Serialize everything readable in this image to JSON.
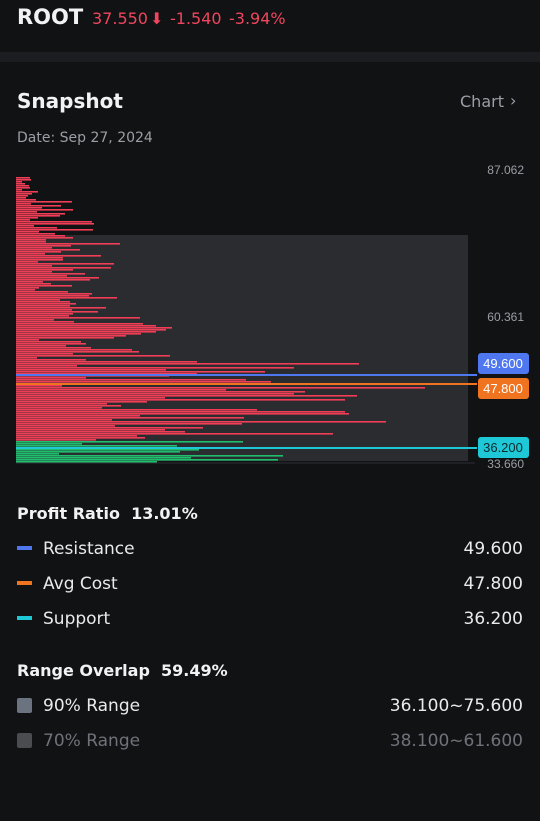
{
  "header": {
    "ticker": "ROOT",
    "price": "37.550",
    "arrow_icon": "arrow-down-icon",
    "arrow_glyph": "⬇",
    "change": "-1.540",
    "change_pct": "-3.94%"
  },
  "snapshot": {
    "title": "Snapshot",
    "chart_link": "Chart",
    "chart_link_icon": "chevron-right-icon",
    "chev_glyph": "›",
    "date_label": "Date:",
    "date_value": "Sep 27, 2024"
  },
  "chart": {
    "price_labels": [
      "87.062",
      "60.361",
      "33.660"
    ],
    "tags": {
      "resistance": "49.600",
      "avg_cost": "47.800",
      "support": "36.200"
    },
    "colors": {
      "profit": "#ef3e55",
      "loss": "#1fbf6e",
      "resistance": "#4f78f0",
      "avg_cost": "#f07320",
      "support": "#1ec8d6",
      "range_band": "#2a2c30"
    }
  },
  "profit": {
    "label": "Profit Ratio",
    "value": "13.01%"
  },
  "legend": [
    {
      "label": "Resistance",
      "value": "49.600",
      "color": "#4f78f0"
    },
    {
      "label": "Avg Cost",
      "value": "47.800",
      "color": "#f07320"
    },
    {
      "label": "Support",
      "value": "36.200",
      "color": "#1ec8d6"
    }
  ],
  "range": {
    "label": "Range Overlap",
    "value": "59.49%"
  },
  "ranges": [
    {
      "label": "90% Range",
      "value": "36.100~75.600",
      "color": "#6b7280"
    },
    {
      "label": "70% Range",
      "value": "38.100~61.600",
      "color": "#4a4c50"
    }
  ]
}
